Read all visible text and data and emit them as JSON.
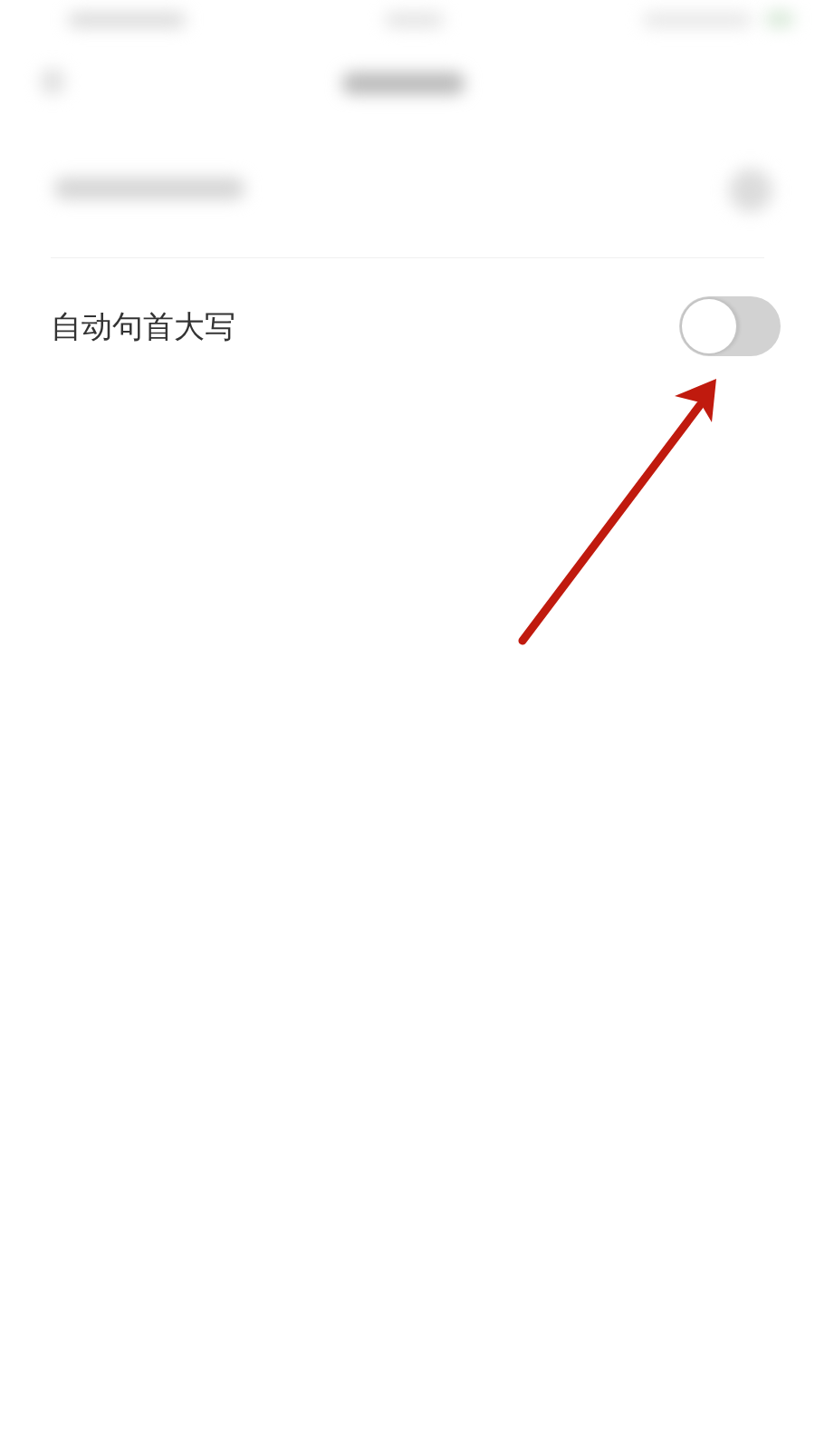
{
  "status_bar": {
    "blurred": true
  },
  "nav_bar": {
    "blurred": true
  },
  "settings": [
    {
      "kind": "blurred"
    },
    {
      "kind": "toggle",
      "label": "自动句首大写",
      "on": false
    }
  ],
  "annotations": [
    {
      "kind": "arrow"
    }
  ]
}
